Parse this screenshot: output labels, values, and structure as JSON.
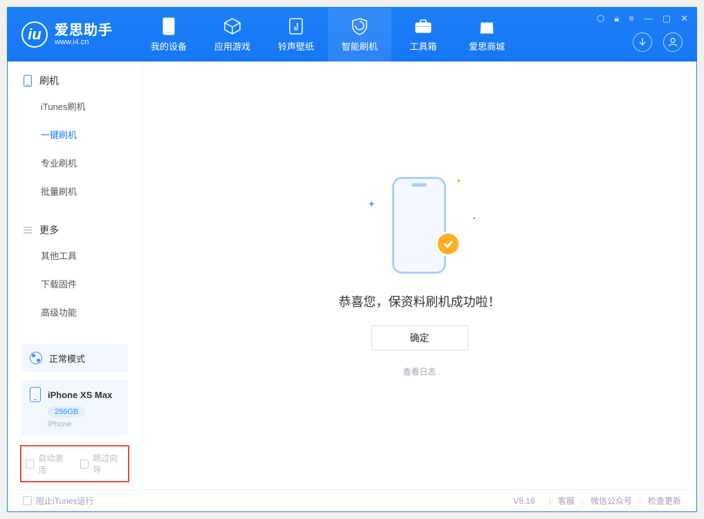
{
  "app": {
    "title": "爱思助手",
    "subtitle": "www.i4.cn"
  },
  "nav": {
    "my_device": "我的设备",
    "apps_games": "应用游戏",
    "ringtones": "铃声壁纸",
    "smart_flash": "智能刷机",
    "toolbox": "工具箱",
    "store": "爱思商城"
  },
  "sidebar": {
    "flash_header": "刷机",
    "itunes_flash": "iTunes刷机",
    "one_click": "一键刷机",
    "pro_flash": "专业刷机",
    "batch_flash": "批量刷机",
    "more_header": "更多",
    "other_tools": "其他工具",
    "download_fw": "下载固件",
    "advanced": "高级功能"
  },
  "mode": {
    "label": "正常模式"
  },
  "device": {
    "name": "iPhone XS Max",
    "storage": "256GB",
    "type": "iPhone"
  },
  "checkboxes": {
    "auto_activate": "自动激活",
    "skip_guide": "跳过向导"
  },
  "main": {
    "success_msg": "恭喜您，保资料刷机成功啦！",
    "ok": "确定",
    "view_log": "查看日志"
  },
  "status": {
    "block_itunes": "阻止iTunes运行",
    "version": "V8.16",
    "support": "客服",
    "wechat": "微信公众号",
    "check_update": "检查更新"
  }
}
